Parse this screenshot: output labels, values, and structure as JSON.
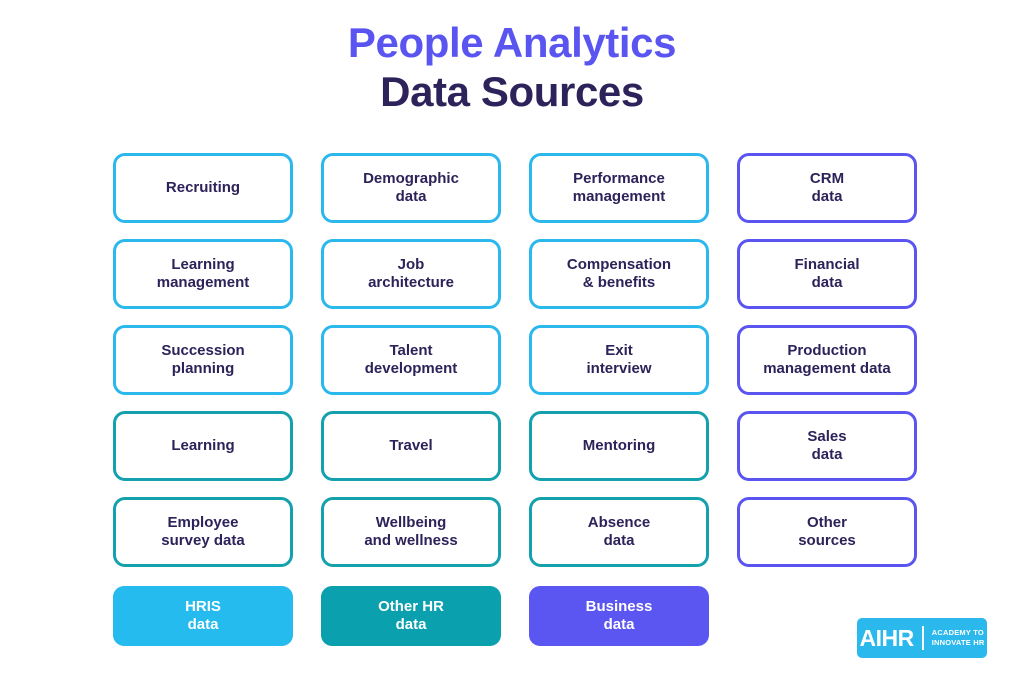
{
  "title": {
    "line1": "People Analytics",
    "line2": "Data Sources",
    "line1_color": "#5a55f0",
    "line2_color": "#2d2259"
  },
  "palette": {
    "cyan": "#2bb8ec",
    "teal": "#14a0ad",
    "purple": "#5a55f0",
    "text_navy": "#2d2259",
    "fill_cyan": "#25bbee",
    "fill_teal": "#0ba0ad",
    "fill_purple": "#5b56f2",
    "background": "#ffffff"
  },
  "grid": {
    "columns": 4,
    "rows": 5,
    "cards": [
      {
        "label": "Recruiting",
        "tone": "cyan",
        "column": 1,
        "row": 1
      },
      {
        "label": "Demographic\ndata",
        "tone": "cyan",
        "column": 2,
        "row": 1
      },
      {
        "label": "Performance\nmanagement",
        "tone": "cyan",
        "column": 3,
        "row": 1
      },
      {
        "label": "CRM\ndata",
        "tone": "purple",
        "column": 4,
        "row": 1
      },
      {
        "label": "Learning\nmanagement",
        "tone": "cyan",
        "column": 1,
        "row": 2
      },
      {
        "label": "Job\narchitecture",
        "tone": "cyan",
        "column": 2,
        "row": 2
      },
      {
        "label": "Compensation\n& benefits",
        "tone": "cyan",
        "column": 3,
        "row": 2
      },
      {
        "label": "Financial\ndata",
        "tone": "purple",
        "column": 4,
        "row": 2
      },
      {
        "label": "Succession\nplanning",
        "tone": "cyan",
        "column": 1,
        "row": 3
      },
      {
        "label": "Talent\ndevelopment",
        "tone": "cyan",
        "column": 2,
        "row": 3
      },
      {
        "label": "Exit\ninterview",
        "tone": "cyan",
        "column": 3,
        "row": 3
      },
      {
        "label": "Production\nmanagement data",
        "tone": "purple",
        "column": 4,
        "row": 3
      },
      {
        "label": "Learning",
        "tone": "teal",
        "column": 1,
        "row": 4
      },
      {
        "label": "Travel",
        "tone": "teal",
        "column": 2,
        "row": 4
      },
      {
        "label": "Mentoring",
        "tone": "teal",
        "column": 3,
        "row": 4
      },
      {
        "label": "Sales\ndata",
        "tone": "purple",
        "column": 4,
        "row": 4
      },
      {
        "label": "Employee\nsurvey data",
        "tone": "teal",
        "column": 1,
        "row": 5
      },
      {
        "label": "Wellbeing\nand wellness",
        "tone": "teal",
        "column": 2,
        "row": 5
      },
      {
        "label": "Absence\ndata",
        "tone": "teal",
        "column": 3,
        "row": 5
      },
      {
        "label": "Other\nsources",
        "tone": "purple",
        "column": 4,
        "row": 5
      }
    ]
  },
  "summary": {
    "cards": [
      {
        "label": "HRIS\ndata",
        "fill": "cyan"
      },
      {
        "label": "Other HR\ndata",
        "fill": "teal"
      },
      {
        "label": "Business\ndata",
        "fill": "purple"
      }
    ]
  },
  "logo": {
    "mark": "AIHR",
    "tagline": "ACADEMY TO\nINNOVATE HR"
  }
}
